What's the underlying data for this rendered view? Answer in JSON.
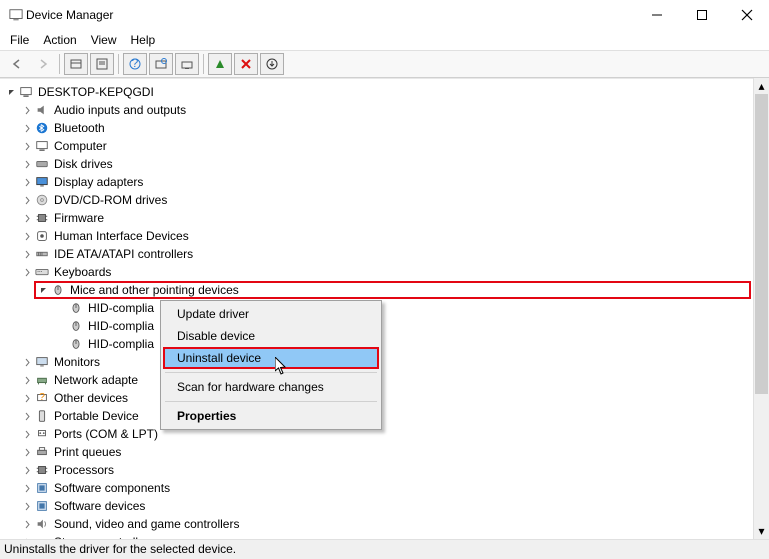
{
  "window": {
    "title": "Device Manager"
  },
  "menu": {
    "file": "File",
    "action": "Action",
    "view": "View",
    "help": "Help"
  },
  "tree": {
    "root": "DESKTOP-KEPQGDI",
    "items": [
      "Audio inputs and outputs",
      "Bluetooth",
      "Computer",
      "Disk drives",
      "Display adapters",
      "DVD/CD-ROM drives",
      "Firmware",
      "Human Interface Devices",
      "IDE ATA/ATAPI controllers",
      "Keyboards",
      "Mice and other pointing devices",
      "Monitors",
      "Network adapte",
      "Other devices",
      "Portable Device",
      "Ports (COM & LPT)",
      "Print queues",
      "Processors",
      "Software components",
      "Software devices",
      "Sound, video and game controllers",
      "Storage controllers"
    ],
    "mice_children": [
      "HID-complia",
      "HID-complia",
      "HID-complia"
    ]
  },
  "context_menu": {
    "update": "Update driver",
    "disable": "Disable device",
    "uninstall": "Uninstall device",
    "scan": "Scan for hardware changes",
    "properties": "Properties"
  },
  "status_bar": "Uninstalls the driver for the selected device."
}
